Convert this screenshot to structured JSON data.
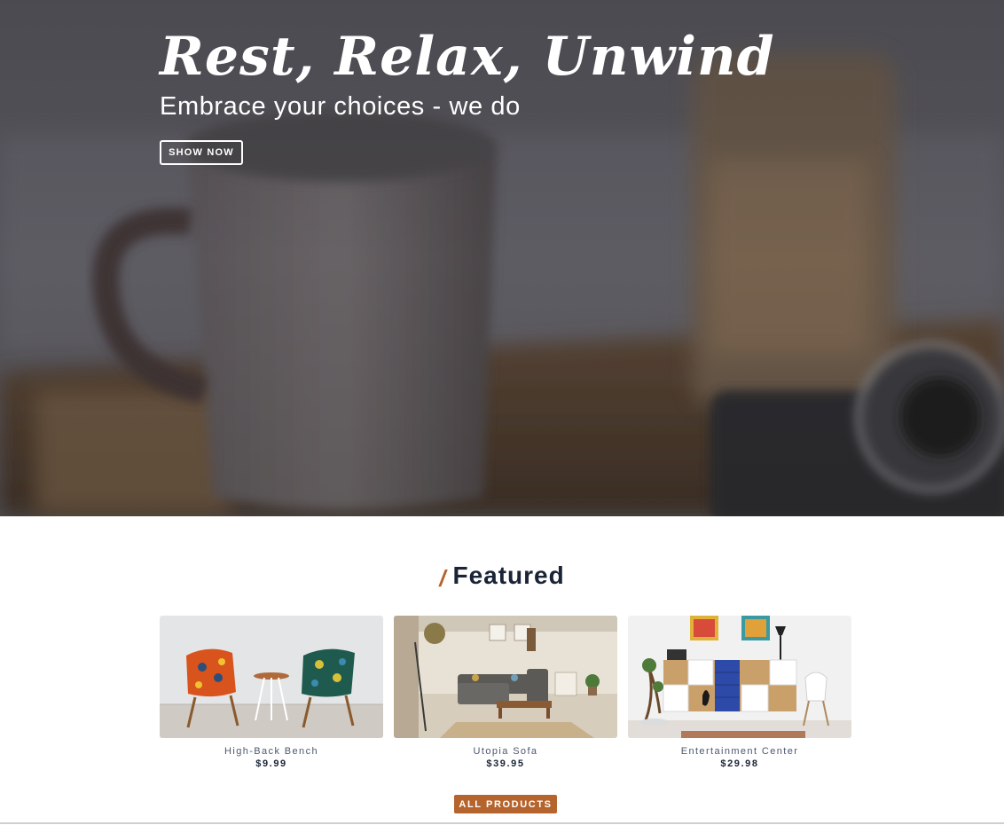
{
  "hero": {
    "title": "Rest, Relax, Unwind",
    "subtitle": "Embrace your choices - we do",
    "button_label": "SHOW NOW",
    "background_image": "blurred-coffee-mug-photo"
  },
  "featured": {
    "slash": "/",
    "title": "Featured",
    "products": [
      {
        "name": "High-Back Bench",
        "price": "$9.99",
        "image": "two-patterned-chairs-photo"
      },
      {
        "name": "Utopia Sofa",
        "price": "$39.95",
        "image": "living-room-sofa-photo"
      },
      {
        "name": "Entertainment Center",
        "price": "$29.98",
        "image": "white-cabinet-shelf-photo"
      }
    ],
    "all_products_label": "ALL PRODUCTS"
  },
  "colors": {
    "accent": "#b5642d",
    "heading": "#1a2436",
    "product_name": "#4a5870"
  }
}
